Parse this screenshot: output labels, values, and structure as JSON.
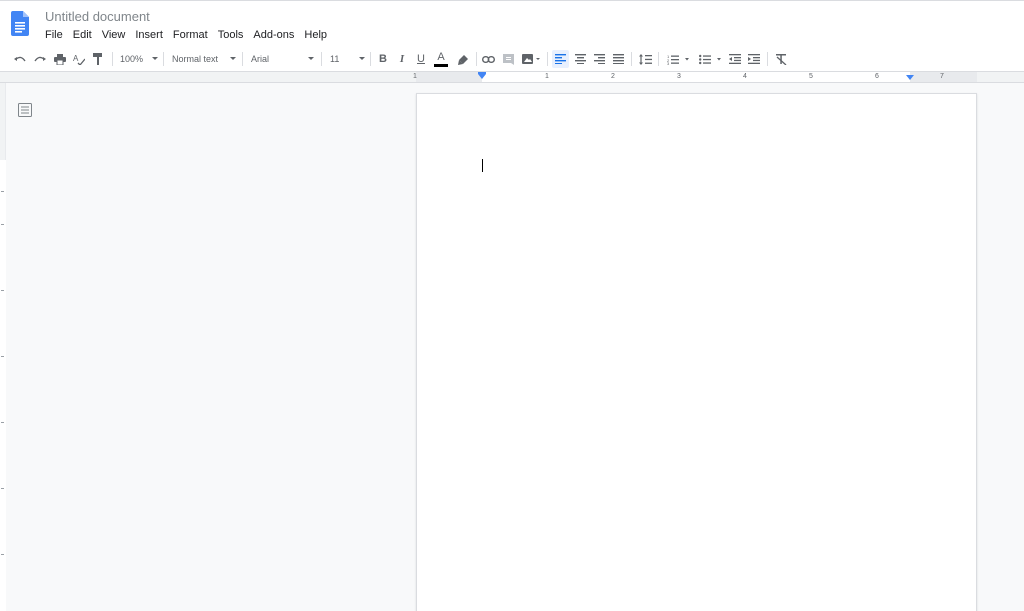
{
  "document": {
    "title": "Untitled document"
  },
  "menu": [
    {
      "label": "File"
    },
    {
      "label": "Edit"
    },
    {
      "label": "View"
    },
    {
      "label": "Insert"
    },
    {
      "label": "Format"
    },
    {
      "label": "Tools"
    },
    {
      "label": "Add-ons"
    },
    {
      "label": "Help"
    }
  ],
  "toolbar": {
    "zoom": "100%",
    "style": "Normal text",
    "font": "Arial",
    "font_size": "11",
    "bold": "B",
    "italic": "I",
    "underline": "U",
    "text_color_letter": "A",
    "text_color": "#000000"
  },
  "ruler": {
    "numbers": [
      "1",
      "1",
      "2",
      "3",
      "4",
      "5",
      "6",
      "7"
    ]
  },
  "colors": {
    "accent": "#4285f4",
    "doc_icon": "#4285f4",
    "active_align_bg": "#e8f0fe"
  },
  "icons": [
    "docs-logo-icon",
    "undo-icon",
    "redo-icon",
    "print-icon",
    "spellcheck-icon",
    "paint-format-icon",
    "highlight-icon",
    "link-icon",
    "comment-icon",
    "image-icon",
    "align-left-icon",
    "align-center-icon",
    "align-right-icon",
    "justify-icon",
    "line-spacing-icon",
    "numbered-list-icon",
    "bulleted-list-icon",
    "decrease-indent-icon",
    "increase-indent-icon",
    "clear-formatting-icon",
    "outline-icon"
  ]
}
